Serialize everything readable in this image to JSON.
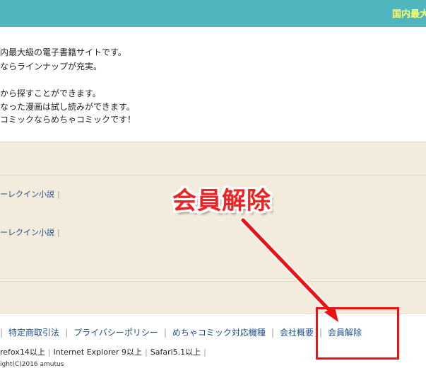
{
  "header": {
    "tagline": "国内最大"
  },
  "intro": {
    "lines": [
      "内最大級の電子書籍サイトです。",
      "ならラインナップが充実。",
      "",
      "から探すことができます。",
      "なった漫画は試し読みができます。",
      "コミックならめちゃコミックです！"
    ]
  },
  "panel": {
    "links": [
      "ーレクイン小説",
      "ーレクイン小説"
    ]
  },
  "footer": {
    "links": [
      "特定商取引法",
      "プライバシーポリシー",
      "めちゃコミック対応機種",
      "会社概要",
      "会員解除"
    ],
    "browsers": [
      "refox14以上",
      "Internet Explorer 9以上",
      "Safari5.1以上"
    ],
    "copyright": "ight(C)2016 amutus"
  },
  "annotation": {
    "callout": "会員解除",
    "color": "#ee1111"
  },
  "colors": {
    "header_bg": "#4fb6bd",
    "tagline": "#ffff66",
    "panel_bg": "#f3ecdd",
    "link": "#1d4d8a"
  }
}
